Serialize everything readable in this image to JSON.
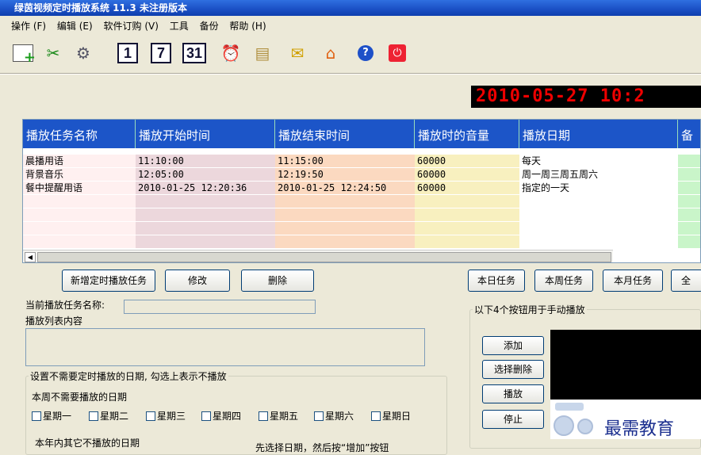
{
  "window": {
    "title": "绿茵视频定时播放系统 11.3   未注册版本"
  },
  "menu": [
    "操作 (F)",
    "编辑 (E)",
    "软件订购 (V)",
    "工具",
    "备份",
    "帮助 (H)"
  ],
  "toolbar": {
    "cal1": "1",
    "cal7": "7",
    "cal31": "31"
  },
  "clock": "2010-05-27 10:2",
  "table": {
    "columns": [
      "播放任务名称",
      "播放开始时间",
      "播放结束时间",
      "播放时的音量",
      "播放日期",
      "备"
    ],
    "rows": [
      [
        "晨播用语",
        "11:10:00",
        "11:15:00",
        "60000",
        "每天",
        ""
      ],
      [
        "背景音乐",
        "12:05:00",
        "12:19:50",
        "60000",
        "周一周三周五周六",
        ""
      ],
      [
        "餐中提醒用语",
        "2010-01-25 12:20:36",
        "2010-01-25 12:24:50",
        "60000",
        "指定的一天",
        ""
      ],
      [
        "",
        "",
        "",
        "",
        "",
        ""
      ],
      [
        "",
        "",
        "",
        "",
        "",
        ""
      ],
      [
        "",
        "",
        "",
        "",
        "",
        ""
      ],
      [
        "",
        "",
        "",
        "",
        "",
        ""
      ]
    ]
  },
  "actions": {
    "add": "新增定时播放任务",
    "edit": "修改",
    "delete": "删除"
  },
  "filters": {
    "today": "本日任务",
    "week": "本周任务",
    "month": "本月任务",
    "all": "全"
  },
  "current": {
    "name_label": "当前播放任务名称:",
    "list_label": "播放列表内容"
  },
  "exclude": {
    "group_title": "设置不需要定时播放的日期, 勾选上表示不播放",
    "week_label": "本周不需要播放的日期",
    "days": [
      "星期一",
      "星期二",
      "星期三",
      "星期四",
      "星期五",
      "星期六",
      "星期日"
    ],
    "year_label": "本年内其它不播放的日期",
    "hint": "先选择日期，然后按“增加”按钮"
  },
  "manual": {
    "group_title": "以下4个按钮用于手动播放",
    "add": "添加",
    "remove": "选择删除",
    "play": "播放",
    "stop": "停止"
  },
  "watermark": "最需教育"
}
